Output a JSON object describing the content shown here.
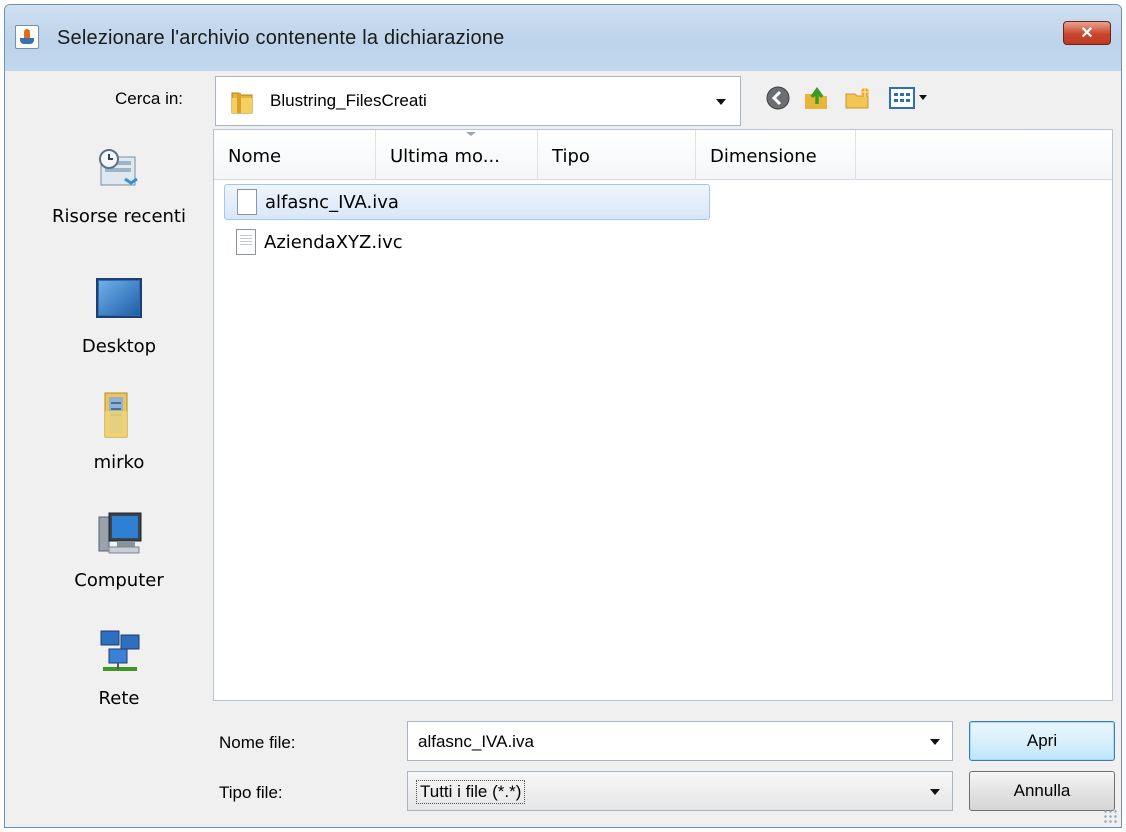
{
  "window": {
    "title": "Selezionare l'archivio contenente la dichiarazione",
    "close_label": "✕"
  },
  "lookin": {
    "label": "Cerca in:",
    "value": "Blustring_FilesCreati"
  },
  "toolbar": {
    "icons": [
      "back-icon",
      "up-folder-icon",
      "new-folder-icon",
      "view-menu-icon"
    ]
  },
  "places": [
    {
      "label": "Risorse recenti",
      "icon": "recent-places-icon"
    },
    {
      "label": "Desktop",
      "icon": "desktop-icon"
    },
    {
      "label": "mirko",
      "icon": "user-folder-icon"
    },
    {
      "label": "Computer",
      "icon": "computer-icon"
    },
    {
      "label": "Rete",
      "icon": "network-icon"
    }
  ],
  "filelist": {
    "columns": [
      "Nome",
      "Ultima mo...",
      "Tipo",
      "Dimensione"
    ],
    "files": [
      {
        "name": "alfasnc_IVA.iva",
        "selected": true
      },
      {
        "name": "AziendaXYZ.ivc",
        "selected": false
      }
    ]
  },
  "filename": {
    "label": "Nome file:",
    "value": "alfasnc_IVA.iva"
  },
  "filetype": {
    "label": "Tipo file:",
    "value": "Tutti i file (*.*)"
  },
  "buttons": {
    "open": "Apri",
    "cancel": "Annulla"
  },
  "colors": {
    "titlebar": "#bcd3ea",
    "close": "#c8452d",
    "selection": "#d8e8f8"
  }
}
